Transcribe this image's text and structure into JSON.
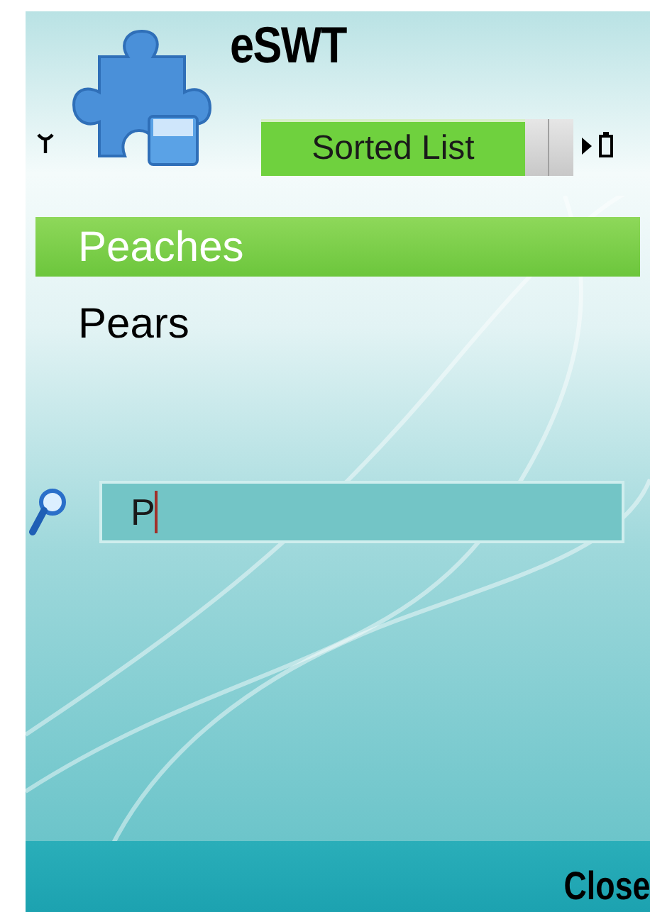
{
  "title": "eSWT",
  "tabs": [
    {
      "label": "Sorted List",
      "selected": true
    }
  ],
  "list": {
    "items": [
      {
        "label": "Peaches",
        "selected": true
      },
      {
        "label": "Pears",
        "selected": false
      }
    ]
  },
  "search": {
    "value": "P"
  },
  "softkeys": {
    "right": "Close"
  }
}
